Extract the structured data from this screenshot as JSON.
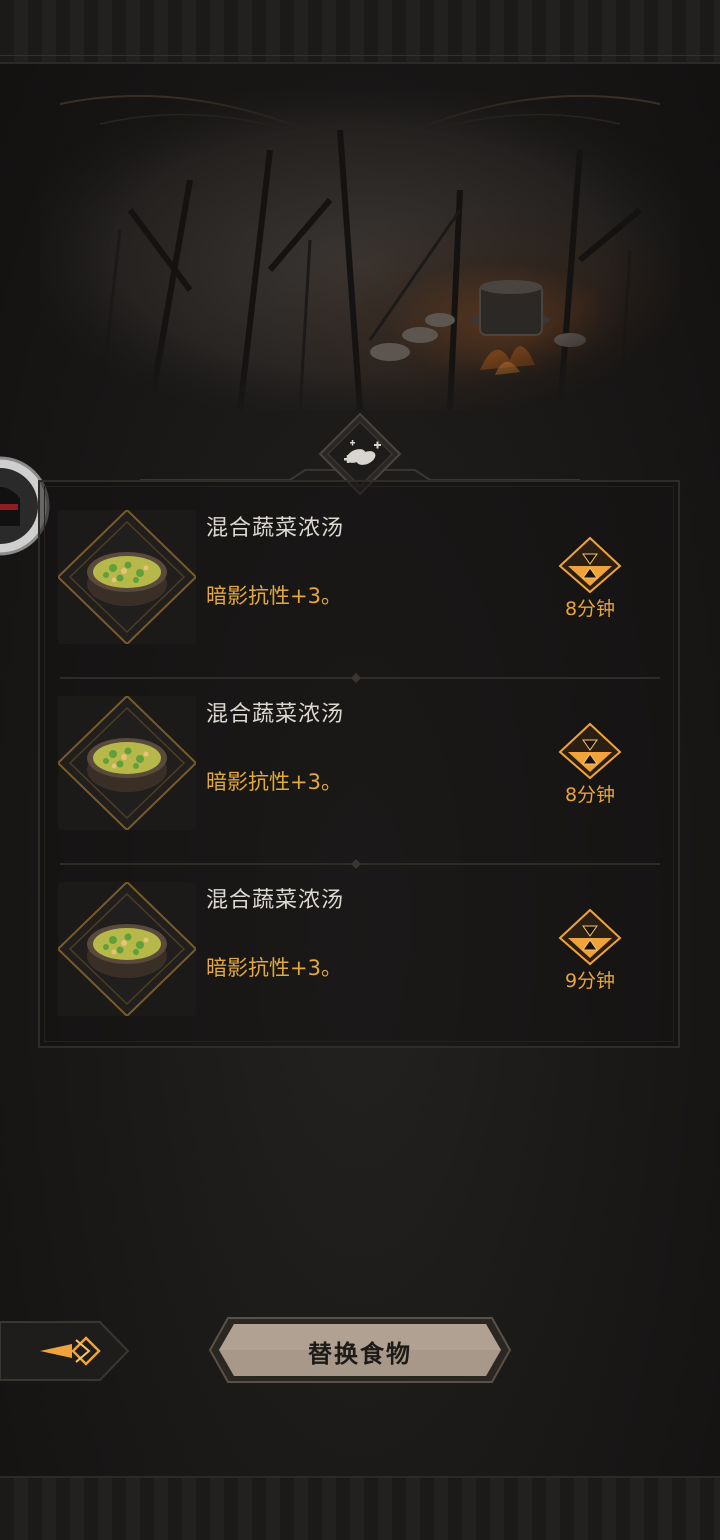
{
  "screen": {
    "title_icon": "food-buff-icon",
    "accent_color": "#e3a93a",
    "timer_color": "#f0a33a"
  },
  "food_list": [
    {
      "name": "混合蔬菜浓汤",
      "effect": "暗影抗性+3。",
      "duration": "8分钟",
      "icon": "soup-bowl-icon"
    },
    {
      "name": "混合蔬菜浓汤",
      "effect": "暗影抗性+3。",
      "duration": "8分钟",
      "icon": "soup-bowl-icon"
    },
    {
      "name": "混合蔬菜浓汤",
      "effect": "暗影抗性+3。",
      "duration": "9分钟",
      "icon": "soup-bowl-icon"
    }
  ],
  "actions": {
    "replace_food_label": "替换食物",
    "back_icon": "arrow-left-icon"
  },
  "side": {
    "avatar_icon": "hooded-avatar-icon"
  }
}
